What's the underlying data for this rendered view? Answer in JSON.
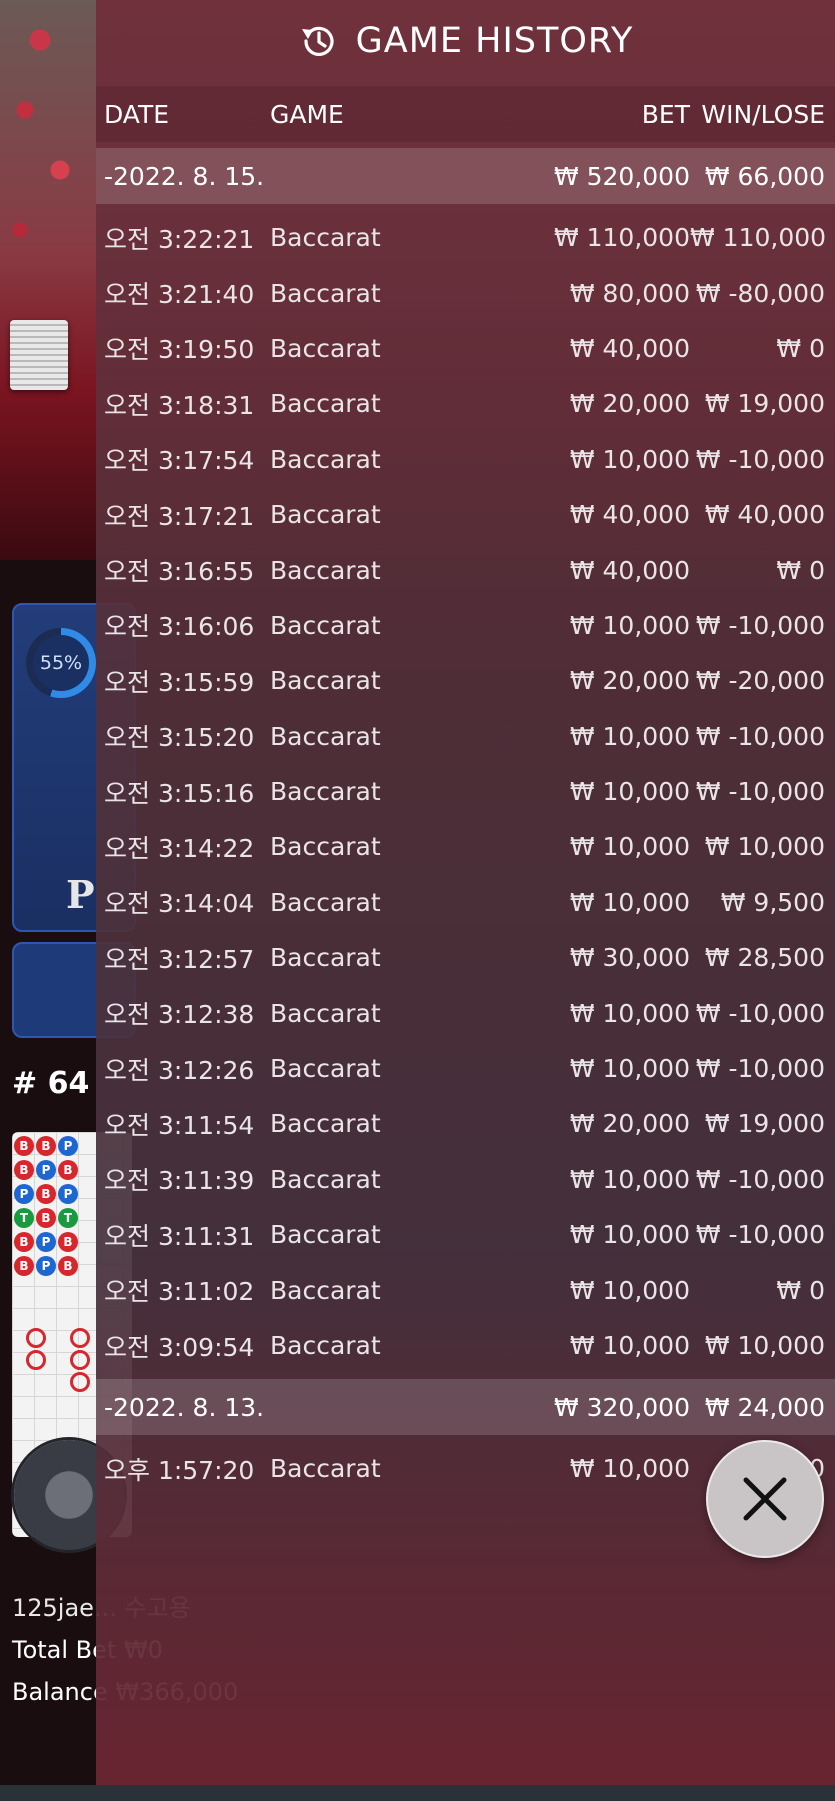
{
  "background": {
    "percent_label": "55%",
    "player_letter": "P",
    "round_label": "# 64",
    "user_line": "125jae... 수고용",
    "total_bet": "Total Bet ₩0",
    "balance": "Balance ₩366,000"
  },
  "history": {
    "title": "GAME HISTORY",
    "icon": "history-clock-icon",
    "columns": {
      "date": "DATE",
      "game": "GAME",
      "bet": "BET",
      "win": "WIN/LOSE"
    },
    "groups": [
      {
        "date": "-2022. 8. 15.",
        "bet_total": "₩ 520,000",
        "win_total": "₩ 66,000",
        "rows": [
          {
            "time": "오전 3:22:21",
            "game": "Baccarat",
            "bet": "₩ 110,000",
            "win": "₩ 110,000"
          },
          {
            "time": "오전 3:21:40",
            "game": "Baccarat",
            "bet": "₩ 80,000",
            "win": "₩ -80,000"
          },
          {
            "time": "오전 3:19:50",
            "game": "Baccarat",
            "bet": "₩ 40,000",
            "win": "₩ 0"
          },
          {
            "time": "오전 3:18:31",
            "game": "Baccarat",
            "bet": "₩ 20,000",
            "win": "₩ 19,000"
          },
          {
            "time": "오전 3:17:54",
            "game": "Baccarat",
            "bet": "₩ 10,000",
            "win": "₩ -10,000"
          },
          {
            "time": "오전 3:17:21",
            "game": "Baccarat",
            "bet": "₩ 40,000",
            "win": "₩ 40,000"
          },
          {
            "time": "오전 3:16:55",
            "game": "Baccarat",
            "bet": "₩ 40,000",
            "win": "₩ 0"
          },
          {
            "time": "오전 3:16:06",
            "game": "Baccarat",
            "bet": "₩ 10,000",
            "win": "₩ -10,000"
          },
          {
            "time": "오전 3:15:59",
            "game": "Baccarat",
            "bet": "₩ 20,000",
            "win": "₩ -20,000"
          },
          {
            "time": "오전 3:15:20",
            "game": "Baccarat",
            "bet": "₩ 10,000",
            "win": "₩ -10,000"
          },
          {
            "time": "오전 3:15:16",
            "game": "Baccarat",
            "bet": "₩ 10,000",
            "win": "₩ -10,000"
          },
          {
            "time": "오전 3:14:22",
            "game": "Baccarat",
            "bet": "₩ 10,000",
            "win": "₩ 10,000"
          },
          {
            "time": "오전 3:14:04",
            "game": "Baccarat",
            "bet": "₩ 10,000",
            "win": "₩ 9,500"
          },
          {
            "time": "오전 3:12:57",
            "game": "Baccarat",
            "bet": "₩ 30,000",
            "win": "₩ 28,500"
          },
          {
            "time": "오전 3:12:38",
            "game": "Baccarat",
            "bet": "₩ 10,000",
            "win": "₩ -10,000"
          },
          {
            "time": "오전 3:12:26",
            "game": "Baccarat",
            "bet": "₩ 10,000",
            "win": "₩ -10,000"
          },
          {
            "time": "오전 3:11:54",
            "game": "Baccarat",
            "bet": "₩ 20,000",
            "win": "₩ 19,000"
          },
          {
            "time": "오전 3:11:39",
            "game": "Baccarat",
            "bet": "₩ 10,000",
            "win": "₩ -10,000"
          },
          {
            "time": "오전 3:11:31",
            "game": "Baccarat",
            "bet": "₩ 10,000",
            "win": "₩ -10,000"
          },
          {
            "time": "오전 3:11:02",
            "game": "Baccarat",
            "bet": "₩ 10,000",
            "win": "₩ 0"
          },
          {
            "time": "오전 3:09:54",
            "game": "Baccarat",
            "bet": "₩ 10,000",
            "win": "₩ 10,000"
          }
        ]
      },
      {
        "date": "-2022. 8. 13.",
        "bet_total": "₩ 320,000",
        "win_total": "₩ 24,000",
        "rows": [
          {
            "time": "오후 1:57:20",
            "game": "Baccarat",
            "bet": "₩ 10,000",
            "win": "₩ 0"
          }
        ]
      }
    ],
    "close_icon": "close-icon"
  }
}
